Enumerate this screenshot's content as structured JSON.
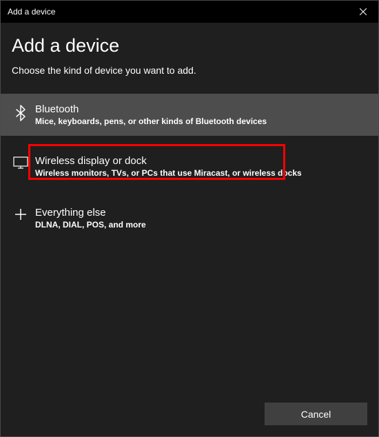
{
  "titlebar": {
    "title": "Add a device"
  },
  "heading": "Add a device",
  "subheading": "Choose the kind of device you want to add.",
  "options": {
    "bluetooth": {
      "title": "Bluetooth",
      "desc": "Mice, keyboards, pens, or other kinds of Bluetooth devices"
    },
    "wireless": {
      "title": "Wireless display or dock",
      "desc": "Wireless monitors, TVs, or PCs that use Miracast, or wireless docks"
    },
    "everything": {
      "title": "Everything else",
      "desc": "DLNA, DIAL, POS, and more"
    }
  },
  "footer": {
    "cancel_label": "Cancel"
  }
}
